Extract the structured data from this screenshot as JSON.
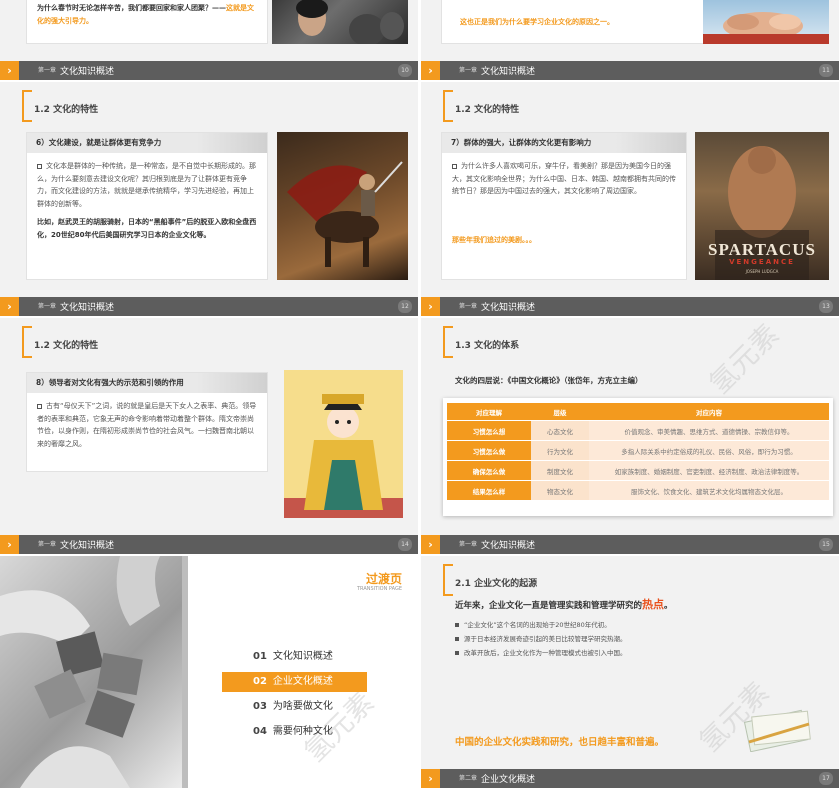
{
  "slides": {
    "s10": {
      "text": "为什么春节时无论怎样辛苦，我们都要回家和家人团聚？——",
      "highlight": "这就是文化的强大引导力。",
      "section": "第一章",
      "title": "文化知识概述",
      "page": "10"
    },
    "s11": {
      "text": "这也正是我们为什么要学习企业文化的原因之一。",
      "section": "第一章",
      "title": "文化知识概述",
      "page": "11"
    },
    "s12": {
      "heading": "1.2 文化的特性",
      "card_title": "6）文化建设，就是让群体更有竞争力",
      "para1": "文化本是群体的一种传统，是一种常态，是不自觉中长期形成的。那么，为什么要刻意去建设文化呢？其归根到底是为了让群体更有竞争力，而文化建设的方法，就就是继承传统精华，学习先进经验，再加上群体的创新等。",
      "para2_a": "比如，赵武灵王的",
      "para2_hl1": "胡服骑射",
      "para2_b": "，日本的“黑船事件”后的",
      "para2_hl2": "脱亚入欧和全盘西化",
      "para2_c": "，20世纪80年代后",
      "para2_hl3": "美国研究",
      "para2_d": "学习日本的企业文化等。",
      "section": "第一章",
      "title": "文化知识概述",
      "page": "12"
    },
    "s13": {
      "heading": "1.2 文化的特性",
      "card_title": "7）群体的强大，让群体的文化更有影响力",
      "para1": "为什么许多人喜欢喝可乐，穿牛仔，看美剧？那是因为美国今日的强大，其文化影响全世界；为什么中国、日本、韩国、越南都拥有共同的传统节日？那是因为中国过去的强大，其文化影响了周边国家。",
      "highlight": "那些年我们追过的美剧。。。",
      "poster_title": "SPARTACUS",
      "poster_sub": "VENGEANCE",
      "poster_credit": "JOSEPH LUDGCA",
      "section": "第一章",
      "title": "文化知识概述",
      "page": "13"
    },
    "s14": {
      "heading": "1.2 文化的特性",
      "card_title": "8）领导者对文化有强大的示范和引领的作用",
      "para1": "古有“母仪天下”之词，说的就是皇后是天下女人之表率、典范。领导者的表率和典范，它象无声的命令影响着带动着整个群体。隋文帝崇尚节俭，以身作则，在隋初形成崇尚节俭的社会风气。一扫魏晋南北朝以来的奢靡之风。",
      "section": "第一章",
      "title": "文化知识概述",
      "page": "14"
    },
    "s15": {
      "heading": "1.3 文化的体系",
      "subtitle": "文化的四层说：《中国文化概论》（张岱年，方克立主编）",
      "table": {
        "headers": [
          "对应理解",
          "层级",
          "对应内容"
        ],
        "rows": [
          [
            "习惯怎么想",
            "心态文化",
            "价值观念、审美情趣、思维方式、道德情操、宗教信仰等。"
          ],
          [
            "习惯怎么做",
            "行为文化",
            "多指人际关系中约定俗成的礼仪、民俗、风俗，即行为习惯。"
          ],
          [
            "确保怎么做",
            "制度文化",
            "如家族制度、婚姻制度、官吏制度、经济制度、政治法律制度等。"
          ],
          [
            "结果怎么样",
            "物态文化",
            "服饰文化、饮食文化、建筑艺术文化均属物态文化层。"
          ]
        ]
      },
      "watermark": "氢元素",
      "section": "第一章",
      "title": "文化知识概述",
      "page": "15"
    },
    "s16": {
      "page_title": "过渡页",
      "page_subtitle": "TRANSITION PAGE",
      "toc": [
        {
          "num": "01",
          "label": "文化知识概述"
        },
        {
          "num": "02",
          "label": "企业文化概述"
        },
        {
          "num": "03",
          "label": "为啥要做文化"
        },
        {
          "num": "04",
          "label": "需要何种文化"
        }
      ],
      "watermark": "氢元素"
    },
    "s17": {
      "heading": "2.1 企业文化的起源",
      "lead_a": "近年来，企业文化一直是管理实践和管理学研究的",
      "lead_hl": "热点",
      "lead_b": "。",
      "bullets": [
        "“企业文化”这个名词的出现始于20世纪80年代初。",
        "源于日本经济发展奇迹引起的美日比较管理学研究热潮。",
        "改革开放后，企业文化作为一种管理模式也被引入中国。"
      ],
      "conclusion": "中国的企业文化实践和研究，也日趋丰富和普遍。",
      "watermark": "氢元素",
      "section": "第二章",
      "title": "企业文化概述",
      "page": "17"
    }
  }
}
